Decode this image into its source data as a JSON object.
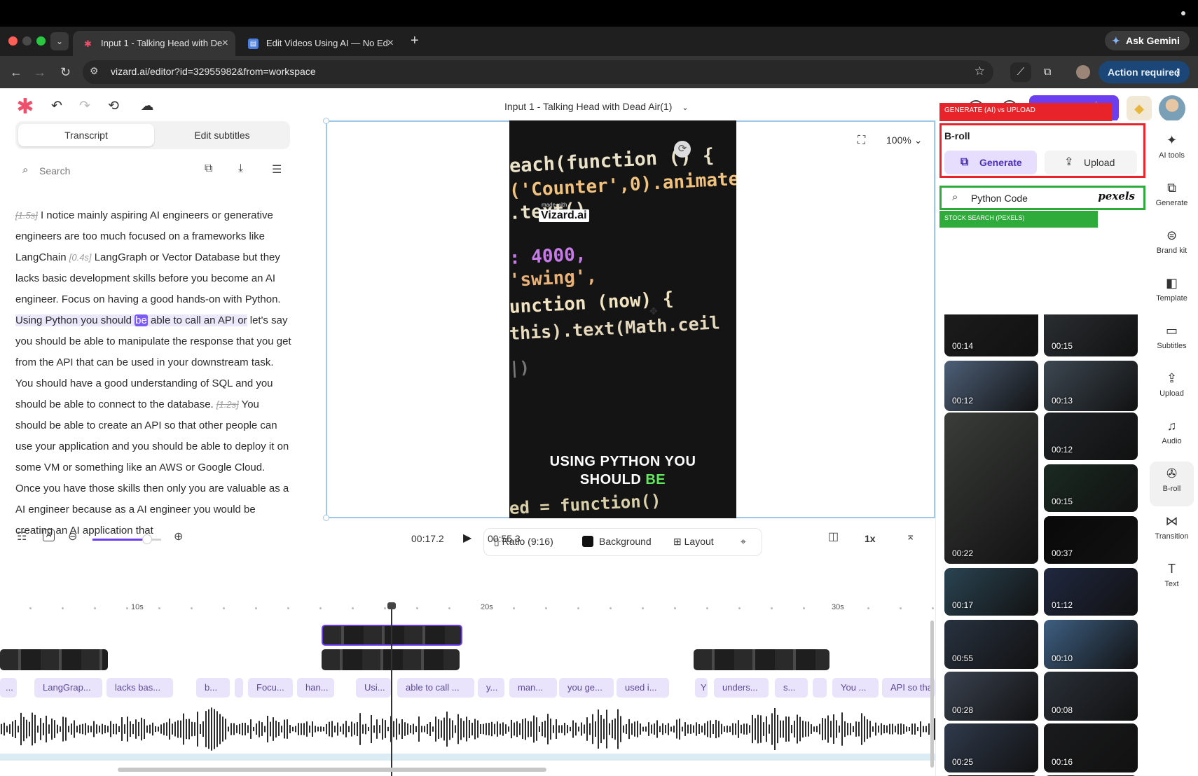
{
  "browser": {
    "tabs": [
      {
        "title": "Input 1 - Talking Head with De",
        "active": true,
        "favicon": "vizard-icon"
      },
      {
        "title": "Edit Videos Using AI — No Ed",
        "active": false,
        "favicon": "doc-icon"
      }
    ],
    "url": "vizard.ai/editor?id=32955982&from=workspace",
    "gemini_label": "Ask Gemini",
    "action_label": "Action required"
  },
  "app": {
    "project_title": "Input 1 - Talking Head with Dead Air(1)",
    "save_label": "Save"
  },
  "transcript_panel": {
    "tabs": [
      "Transcript",
      "Edit subtitles"
    ],
    "search_placeholder": "Search",
    "segments": [
      {
        "t": "[1.5s]",
        "k": "pause-strike"
      },
      {
        "t": " I notice mainly aspiring AI engineers or generative engineers are too much focused on a frameworks like LangChain ",
        "k": "text"
      },
      {
        "t": "[0.4s]",
        "k": "pause"
      },
      {
        "t": " LangGraph or Vector Database but they lacks basic development skills before you become an AI engineer. Focus on having a good hands-on with Python. ",
        "k": "text"
      },
      {
        "t": "Using Python you should ",
        "k": "hl"
      },
      {
        "t": "be",
        "k": "cur"
      },
      {
        "t": " able to call an API or",
        "k": "hl"
      },
      {
        "t": " let's say you should be able to manipulate the response that you get from the API that can be used in your downstream task. You should have a good understanding of SQL and you should be able to connect to the database. ",
        "k": "text"
      },
      {
        "t": "[1.2s]",
        "k": "pause-strike"
      },
      {
        "t": " You should be able to create an API so that other people can use your application and you should be able to deploy it on some VM or something like an AWS or Google Cloud. Once you have those skills then only you are valuable as a AI engineer because as a AI engineer you would be creating an AI application that",
        "k": "text"
      }
    ]
  },
  "preview": {
    "zoom": "100%",
    "watermark_small": "made with",
    "watermark": "Vizard.ai",
    "code_lines": [
      "each(function () {",
      "('Counter',0).animate",
      "     .text()",
      ":  4000,",
      " 'swing',",
      "unction (now) {",
      "this).text(Math.ceil",
      " |)"
    ],
    "caption_line1": "USING PYTHON YOU",
    "caption_line2a": "SHOULD ",
    "caption_line2b": "BE",
    "code_bottom": "ed = function()",
    "toolbar": {
      "ratio": "Ratio (9:16)",
      "background": "Background",
      "layout": "Layout"
    }
  },
  "timeline": {
    "current": "00:17.2",
    "total": "00:55.3",
    "speed": "1x",
    "zoom_level": 0.8,
    "ruler_labels": [
      "10s",
      "20s",
      "30s"
    ],
    "words": [
      "...",
      "LangGrap...",
      "lacks bas...",
      "b...",
      "",
      "Focu...",
      "han...",
      "Usi...",
      "able to call ...",
      "y...",
      "man...",
      "you ge...",
      "used i...",
      "Y",
      "unders...",
      "s...",
      "",
      "You ...",
      "API so tha"
    ]
  },
  "annotations": {
    "red": "GENERATE (AI) vs UPLOAD",
    "green": "STOCK SEARCH (PEXELS)"
  },
  "broll": {
    "title": "B-roll",
    "generate_label": "Generate",
    "upload_label": "Upload",
    "search_value": "Python Code",
    "provider": "pexels",
    "left_durations": [
      "00:14",
      "00:12",
      "00:22",
      "00:17",
      "00:55",
      "00:28",
      "00:25",
      ""
    ],
    "right_durations": [
      "00:15",
      "00:13",
      "00:12",
      "00:15",
      "00:37",
      "01:12",
      "00:10",
      "00:08",
      "00:16",
      ""
    ]
  },
  "rail": [
    {
      "icon": "ai-tools-icon",
      "label": "AI tools"
    },
    {
      "icon": "generate-icon",
      "label": "Generate"
    },
    {
      "icon": "brand-kit-icon",
      "label": "Brand kit"
    },
    {
      "icon": "template-icon",
      "label": "Template"
    },
    {
      "icon": "subtitles-icon",
      "label": "Subtitles"
    },
    {
      "icon": "upload-icon",
      "label": "Upload"
    },
    {
      "icon": "audio-icon",
      "label": "Audio"
    },
    {
      "icon": "broll-icon",
      "label": "B-roll"
    },
    {
      "icon": "transition-icon",
      "label": "Transition"
    },
    {
      "icon": "text-icon",
      "label": "Text"
    }
  ],
  "colors": {
    "accent": "#6b3ef0",
    "annotation_red": "#e8232a",
    "annotation_green": "#2eab3b"
  }
}
